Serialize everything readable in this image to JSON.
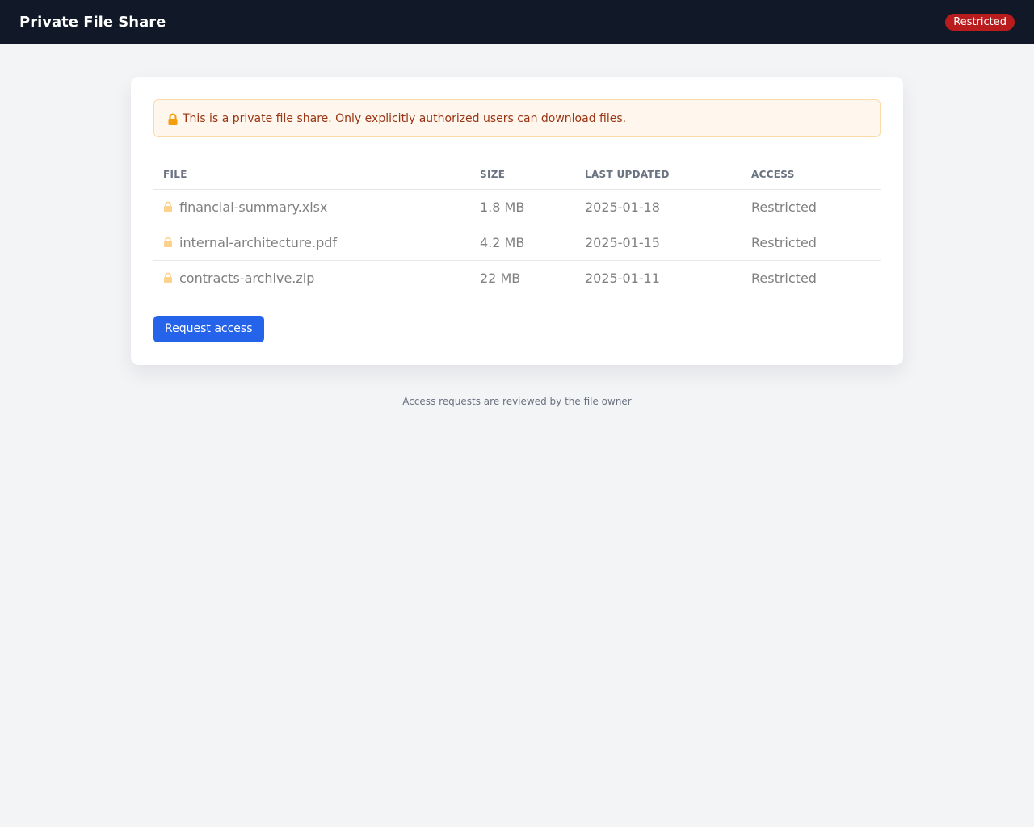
{
  "header": {
    "title": "Private File Share",
    "status_badge": "Restricted"
  },
  "notice": {
    "icon": "lock-icon",
    "text": "This is a private file share. Only explicitly authorized users can download files."
  },
  "table": {
    "columns": [
      "FILE",
      "SIZE",
      "LAST UPDATED",
      "ACCESS"
    ],
    "rows": [
      {
        "icon": "lock-icon",
        "file": "financial-summary.xlsx",
        "size": "1.8 MB",
        "updated": "2025-01-18",
        "access": "Restricted"
      },
      {
        "icon": "lock-icon",
        "file": "internal-architecture.pdf",
        "size": "4.2 MB",
        "updated": "2025-01-15",
        "access": "Restricted"
      },
      {
        "icon": "lock-icon",
        "file": "contracts-archive.zip",
        "size": "22 MB",
        "updated": "2025-01-11",
        "access": "Restricted"
      }
    ]
  },
  "actions": {
    "request_access_label": "Request access"
  },
  "footer": {
    "note": "Access requests are reviewed by the file owner"
  },
  "colors": {
    "header_bg": "#111827",
    "badge_bg": "#b91c1c",
    "notice_bg": "#fff7ed",
    "notice_text": "#9a3412",
    "lock_icon": "#f59e0b",
    "button_bg": "#2563eb"
  }
}
